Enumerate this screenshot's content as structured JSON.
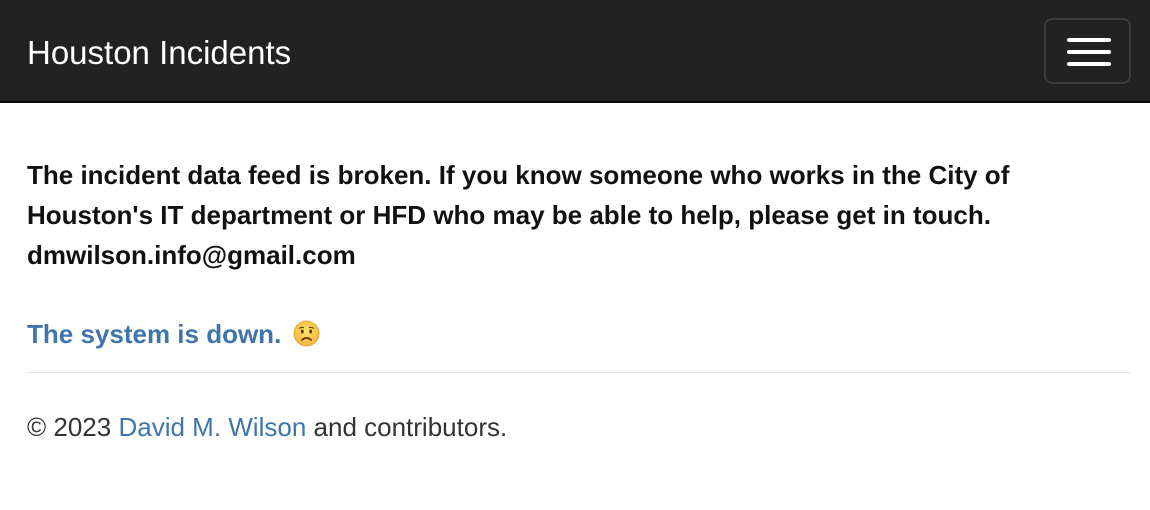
{
  "navbar": {
    "brand": "Houston Incidents",
    "menu_icon": "hamburger-menu-icon"
  },
  "notice": {
    "text": "The incident data feed is broken. If you know someone who works in the City of Houston's IT department or HFD who may be able to help, please get in touch. dmwilson.info@gmail.com"
  },
  "status": {
    "text": "The system is down.",
    "emoji_icon": "worried-face-icon"
  },
  "footer": {
    "prefix": "© 2023",
    "author_link": "David M. Wilson",
    "suffix": "and contributors."
  },
  "colors": {
    "navbar_bg": "#222222",
    "link": "#3f74ad",
    "text": "#111111"
  }
}
